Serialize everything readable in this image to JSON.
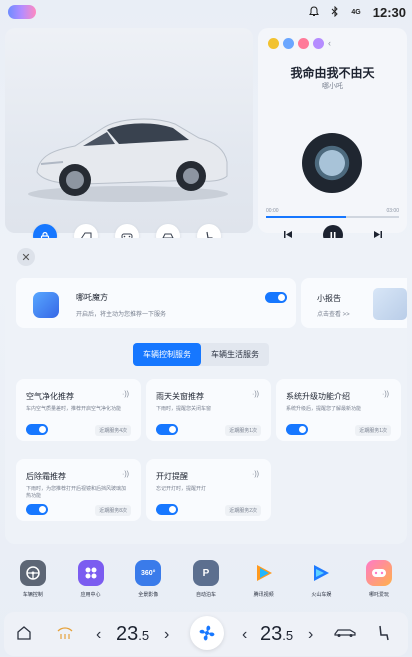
{
  "status": {
    "time": "12:30",
    "signal": "4G"
  },
  "music": {
    "title": "我命由我不由天",
    "artist": "哪小吒",
    "elapsed": "00:00",
    "duration": "03:00",
    "progress_fraction": 0.6
  },
  "panel": {
    "magic": {
      "title": "哪吒魔方",
      "subtitle": "开启后，将主动为您推荐一下服务"
    },
    "report": {
      "title": "小报告",
      "subtitle": "点击查看 >>"
    },
    "tabs": [
      {
        "label": "车辆控制服务",
        "active": true
      },
      {
        "label": "车辆生活服务",
        "active": false
      }
    ],
    "services": [
      {
        "title": "空气净化推荐",
        "desc": "车内空气质量差时，推荐开启空气净化功能",
        "count": "近期服务4次"
      },
      {
        "title": "雨天关窗推荐",
        "desc": "下雨时，提醒您关闭车窗",
        "count": "近期服务1次"
      },
      {
        "title": "系统升级功能介绍",
        "desc": "系统升级后，提醒您了解最新功能",
        "count": "近期服务1次"
      },
      {
        "title": "后除霜推荐",
        "desc": "下雨时，为您推荐打开后视镜和后挡风玻璃加热功能",
        "count": "近期服务8次"
      },
      {
        "title": "开灯提醒",
        "desc": "忘记开灯时，提醒开灯",
        "count": "近期服务2次"
      }
    ]
  },
  "apps": [
    {
      "label": "车辆控制",
      "icon": "steering-wheel-icon",
      "color": "#5d6675"
    },
    {
      "label": "应用中心",
      "icon": "app-grid-icon",
      "color": "#7b5cf0"
    },
    {
      "label": "全景影像",
      "icon": "360-camera-icon",
      "color": "#3a7bea"
    },
    {
      "label": "自动泊车",
      "icon": "auto-parking-icon",
      "color": "#5c6f8f"
    },
    {
      "label": "腾讯视频",
      "icon": "tencent-video-icon",
      "color": "#ffffff"
    },
    {
      "label": "火山车娱",
      "icon": "volcano-video-icon",
      "color": "#ffffff"
    },
    {
      "label": "哪吒爱玩",
      "icon": "gamepad-icon",
      "color": "#ff7ac8"
    }
  ],
  "climate": {
    "left_temp": "23",
    "left_temp_decimal": ".5",
    "right_temp": "23",
    "right_temp_decimal": ".5"
  },
  "colors": {
    "accent": "#1677ff",
    "text": "#1d2330",
    "muted": "#7a8291"
  }
}
